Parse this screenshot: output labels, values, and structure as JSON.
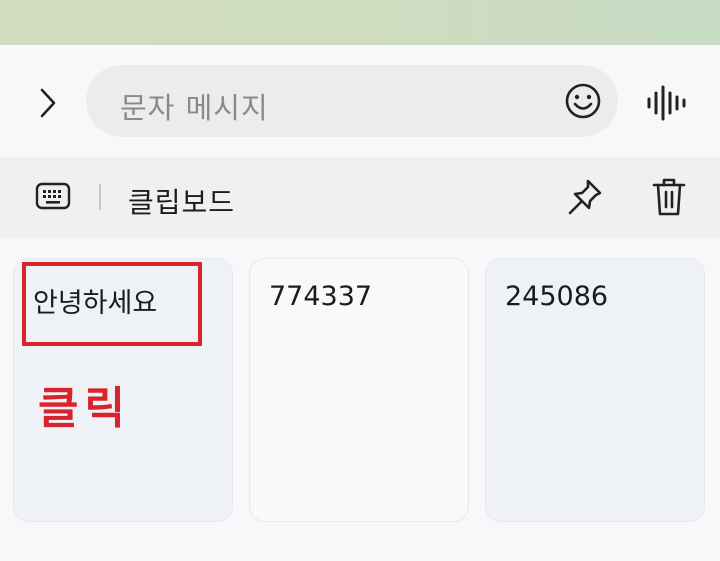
{
  "compose": {
    "placeholder": "문자 메시지"
  },
  "clipboard": {
    "title": "클립보드",
    "items": [
      {
        "text": "안녕하세요"
      },
      {
        "text": "774337"
      },
      {
        "text": "245086"
      }
    ]
  },
  "annotation": {
    "label": "클릭",
    "color": "#d8232a"
  },
  "icons": {
    "expand": "chevron-right-icon",
    "emoji": "emoji-icon",
    "voice": "voice-wave-icon",
    "keyboard": "keyboard-icon",
    "pin": "pin-icon",
    "trash": "trash-icon"
  }
}
